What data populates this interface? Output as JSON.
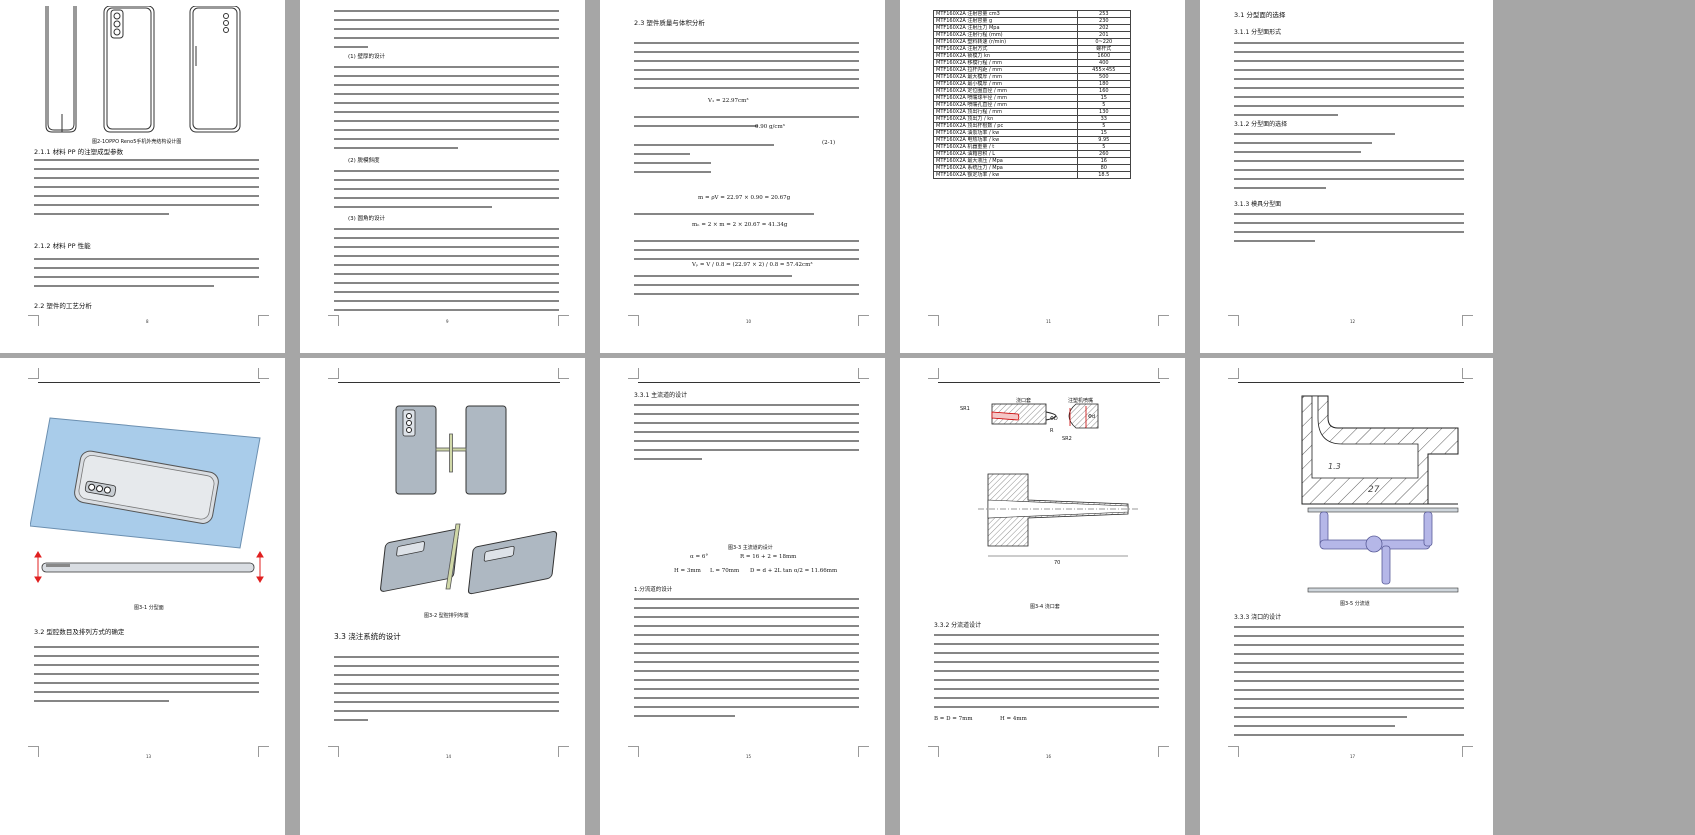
{
  "viewer": {
    "background": "#a6a6a6",
    "page_background": "#ffffff"
  },
  "pages": {
    "p1": {
      "figure_caption": "图2-1OPPO Reno5手机外壳结构设计图",
      "heading_211": "2.1.1 材料 PP 的注塑成型参数",
      "heading_212": "2.1.2 材料 PP 性能",
      "heading_22": "2.2 塑件的工艺分析",
      "page_number": "8"
    },
    "p2": {
      "sub1": "(1) 壁厚的设计",
      "sub2": "(2) 脱模斜度",
      "sub3": "(3) 圆角的设计",
      "page_number": "9"
    },
    "p3": {
      "heading_23": "2.3 塑件质量与体积分析",
      "eq1": "V₁ = 22.97cm³",
      "density": "0.90 g/cm³",
      "eq_mass_label": "(2-1)",
      "eq2": "m = ρV = 22.97 × 0.90 = 20.67g",
      "eq3": "mₙ = 2 × m = 2 × 20.67 = 41.34g",
      "eq4": "Vₚ = V / 0.8 = (22.97 × 2) / 0.8 = 57.42cm³",
      "page_number": "10"
    },
    "p4": {
      "table_rows": [
        [
          "MTF160X2A 注射容量 cm3",
          "253"
        ],
        [
          "MTF160X2A 注射容量 g",
          "230"
        ],
        [
          "MTF160X2A 注射压力 Mpa",
          "202"
        ],
        [
          "MTF160X2A 注射行程 (mm)",
          "201"
        ],
        [
          "MTF160X2A 塑料转速 (r/min)",
          "0~220"
        ],
        [
          "MTF160X2A 注射方式",
          "螺杆式"
        ],
        [
          "MTF160X2A 锁模力 kn",
          "1600"
        ],
        [
          "MTF160X2A 移模行程 / mm",
          "400"
        ],
        [
          "MTF160X2A 拉杆内距 / mm",
          "455×455"
        ],
        [
          "MTF160X2A 最大模厚 / mm",
          "500"
        ],
        [
          "MTF160X2A 最小模厚 / mm",
          "180"
        ],
        [
          "MTF160X2A 定位圈直径 / mm",
          "160"
        ],
        [
          "MTF160X2A 喷嘴球半径 / mm",
          "15"
        ],
        [
          "MTF160X2A 喷嘴孔直径 / mm",
          "5"
        ],
        [
          "MTF160X2A 顶出行程 / mm",
          "130"
        ],
        [
          "MTF160X2A 顶出力 / kn",
          "33"
        ],
        [
          "MTF160X2A 顶出杆根数 / pc",
          "5"
        ],
        [
          "MTF160X2A 油泵功率 / kw",
          "15"
        ],
        [
          "MTF160X2A 电热功率 / kw",
          "9.95"
        ],
        [
          "MTF160X2A 机器重量 / t",
          "5"
        ],
        [
          "MTF160X2A 油箱容积 / L",
          "260"
        ],
        [
          "MTF160X2A 最大液压 / Mpa",
          "16"
        ],
        [
          "MTF160X2A 系统压力 / Mpa",
          "80"
        ],
        [
          "MTF160X2A 额定功率 / kw",
          "18.5"
        ]
      ],
      "page_number": "11"
    },
    "p5": {
      "heading_31": "3.1 分型面的选择",
      "heading_311": "3.1.1 分型面形式",
      "heading_312": "3.1.2 分型面的选择",
      "heading_313": "3.1.3 模具分型面",
      "page_number": "12"
    },
    "p6": {
      "caption_top": "图3-1  分型面",
      "heading_32": "3.2 型腔数目及排列方式的确定",
      "page_number": "13"
    },
    "p7": {
      "caption": "图3-2  型腔排列布置",
      "heading_33": "3.3 浇注系统的设计",
      "page_number": "14"
    },
    "p8": {
      "heading_331": "3.3.1 主流道的设计",
      "caption": "图3-3  主流道的设计",
      "eq_alpha": "α = 6°",
      "eq_R": "R = 16 + 2 = 18mm",
      "eq_H": "H = 3mm",
      "eq_L": "L = 70mm",
      "eq_D": "D = d + 2L tan α/2 = 11.66mm",
      "heading_sub": "1.分流道的设计",
      "page_number": "15"
    },
    "p9": {
      "labels": {
        "sr1": "SR1",
        "sr2": "SR2",
        "sprue": "浇口套",
        "nozzle": "注塑机喷嘴",
        "d": "Φd",
        "D": "ΦD",
        "r": "R",
        "dim70": "70"
      },
      "caption": "图3-4  浇口套",
      "heading_332": "3.3.2 分流道设计",
      "eq_B": "B = D = 7mm",
      "eq_H2": "H = 4mm",
      "page_number": "16"
    },
    "p10": {
      "dim_13": "1.3",
      "dim_27": "27",
      "caption": "图3-5  分流道",
      "heading_333": "3.3.3 浇口的设计",
      "page_number": "17"
    }
  }
}
